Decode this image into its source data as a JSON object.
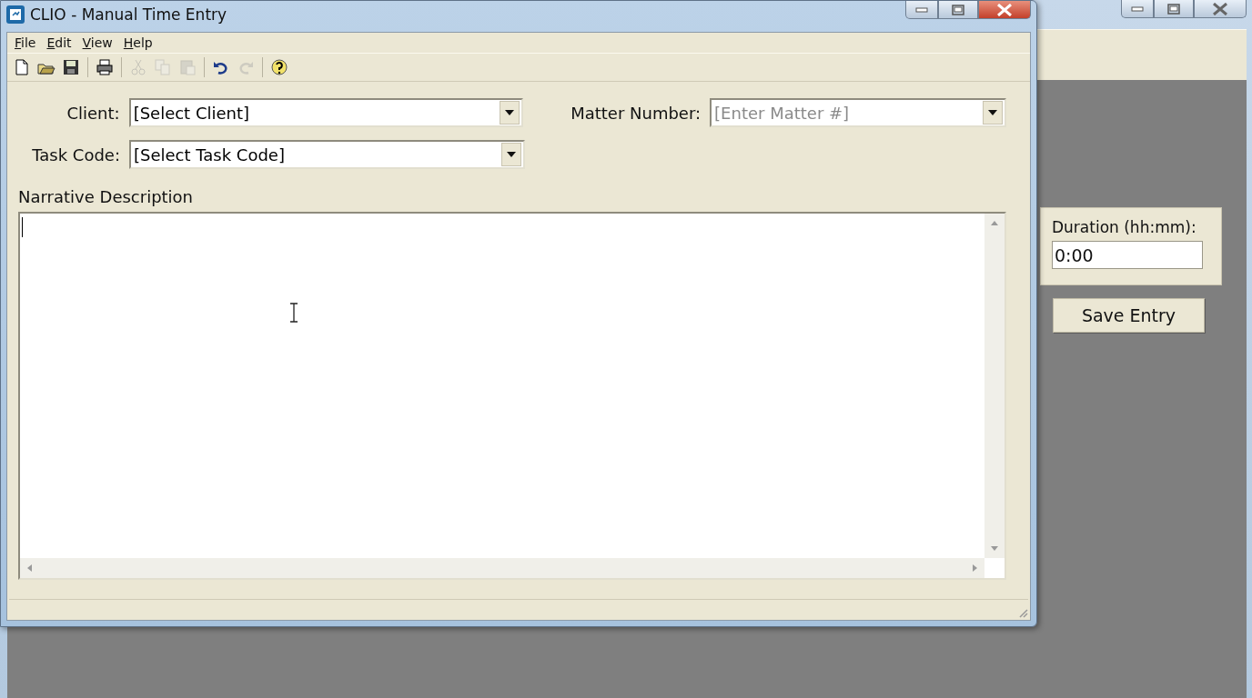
{
  "front_window": {
    "title": "CLIO - Manual Time Entry",
    "menu": [
      {
        "label": "File"
      },
      {
        "label": "Edit"
      },
      {
        "label": "View"
      },
      {
        "label": "Help"
      }
    ],
    "toolbar": [
      {
        "kind": "new",
        "disabled": false
      },
      {
        "kind": "open",
        "disabled": false
      },
      {
        "kind": "save",
        "disabled": false
      },
      {
        "kind": "sep"
      },
      {
        "kind": "print",
        "disabled": false
      },
      {
        "kind": "sep"
      },
      {
        "kind": "cut",
        "disabled": true
      },
      {
        "kind": "copy",
        "disabled": true
      },
      {
        "kind": "paste",
        "disabled": true
      },
      {
        "kind": "sep"
      },
      {
        "kind": "undo",
        "disabled": false
      },
      {
        "kind": "redo",
        "disabled": true
      },
      {
        "kind": "sep"
      },
      {
        "kind": "help",
        "disabled": false
      }
    ],
    "client": {
      "label": "Client:",
      "value": "[Select Client]"
    },
    "matter_number": {
      "label": "Matter Number:",
      "placeholder": "[Enter Matter #]"
    },
    "task_code": {
      "label": "Task Code:",
      "value": "[Select Task Code]"
    },
    "narrative": {
      "label": "Narrative Description"
    }
  },
  "back_window": {
    "duration": {
      "label": "Duration (hh:mm):",
      "value": "0:00"
    },
    "save_button": "Save Entry"
  }
}
